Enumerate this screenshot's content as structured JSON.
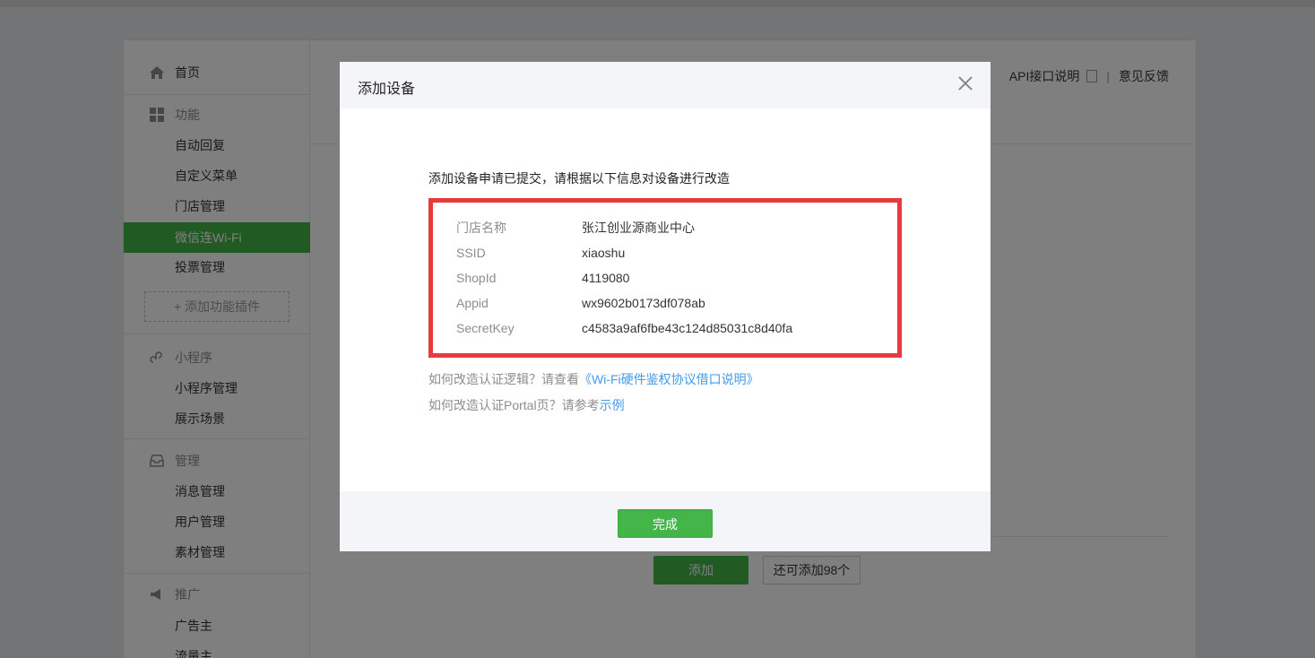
{
  "sidebar": {
    "home": "首页",
    "features_title": "功能",
    "features": [
      "自动回复",
      "自定义菜单",
      "门店管理",
      "微信连Wi-Fi",
      "投票管理"
    ],
    "add_plugin": "+ 添加功能插件",
    "miniprogram_title": "小程序",
    "miniprogram": [
      "小程序管理",
      "展示场景"
    ],
    "manage_title": "管理",
    "manage": [
      "消息管理",
      "用户管理",
      "素材管理"
    ],
    "promo_title": "推广",
    "promo": [
      "广告主",
      "流量主"
    ]
  },
  "header_links": {
    "api": "API接口说明",
    "feedback": "意见反馈"
  },
  "background": {
    "add_button": "添加",
    "remaining": "还可添加98个"
  },
  "dialog": {
    "title": "添加设备",
    "intro": "添加设备申请已提交，请根据以下信息对设备进行改造",
    "rows": [
      {
        "label": "门店名称",
        "value": "张江创业源商业中心"
      },
      {
        "label": "SSID",
        "value": "xiaoshu"
      },
      {
        "label": "ShopId",
        "value": "4119080"
      },
      {
        "label": "Appid",
        "value": "wx9602b0173df078ab"
      },
      {
        "label": "SecretKey",
        "value": "c4583a9af6fbe43c124d85031c8d40fa"
      }
    ],
    "help1_text": "如何改造认证逻辑？请查看",
    "help1_link": "《Wi-Fi硬件鉴权协议借口说明》",
    "help2_text": "如何改造认证Portal页？请参考",
    "help2_link": "示例",
    "done_button": "完成"
  },
  "colors": {
    "accent": "#44b549",
    "highlight_border": "#e83a3f",
    "link": "#459ae9"
  }
}
